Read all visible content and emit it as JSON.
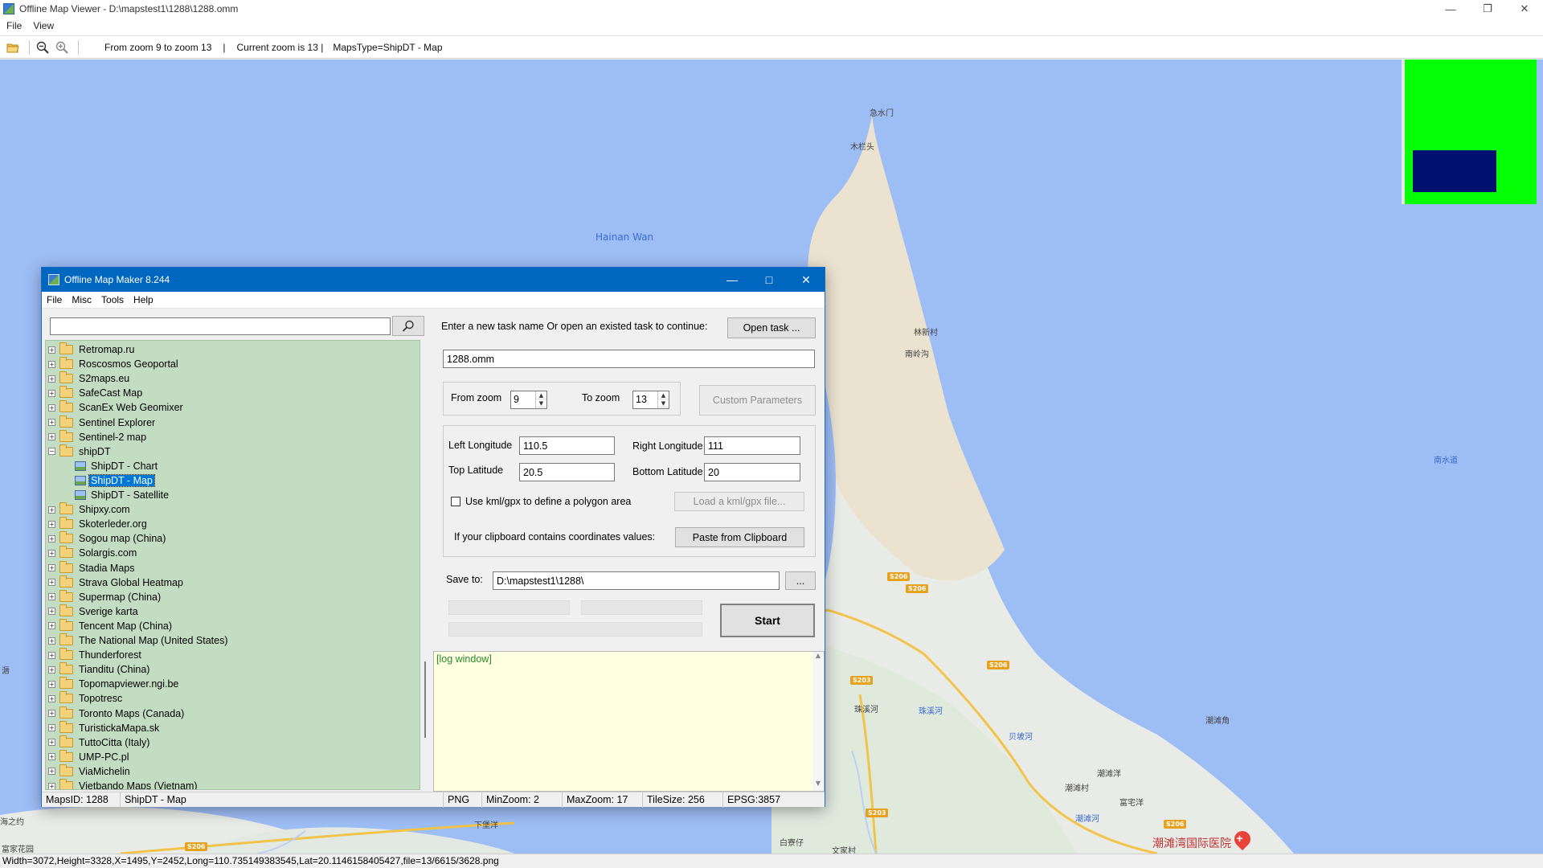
{
  "viewer": {
    "title": "Offline Map Viewer - D:\\mapstest1\\1288\\1288.omm",
    "menu": [
      "File",
      "View"
    ],
    "toolbar": {
      "zoom_range": "From zoom 9 to zoom 13",
      "separator": "|",
      "current_zoom": "Current zoom is 13 |",
      "maps_type": "MapsType=ShipDT - Map"
    },
    "status": "Width=3072,Height=3328,X=1495,Y=2452,Long=110.735149383545,Lat=20.1146158405427,file=13/6615/3628.png"
  },
  "map": {
    "water_labels": [
      "Hainan Wan"
    ],
    "place_labels": [
      "急水门",
      "木栏头",
      "林新村",
      "南岭沟",
      "南水道",
      "珠溪河",
      "珠溪河",
      "贝坡河",
      "潮滩角",
      "潮滩洋",
      "潮滩村",
      "富宅洋",
      "潮滩河",
      "下堡洋",
      "白寮仔",
      "文家村",
      "富家花园",
      "海之约",
      "漘"
    ],
    "road_shields": [
      "S206",
      "S206",
      "S206",
      "S203",
      "S203",
      "S206",
      "S206"
    ],
    "poi": "潮滩湾国际医院",
    "colors": {
      "water": "#9dbdf5",
      "land": "#e9ebe7",
      "sand": "#ebe3cf",
      "minimap": "#05ff05",
      "minimap_view": "#001070"
    }
  },
  "maker": {
    "title": "Offline Map Maker 8.244",
    "menu": [
      "File",
      "Misc",
      "Tools",
      "Help"
    ],
    "search": {
      "value": "",
      "placeholder": ""
    },
    "tree": [
      {
        "label": "Retromap.ru",
        "type": "folder",
        "expanded": false
      },
      {
        "label": "Roscosmos Geoportal",
        "type": "folder",
        "expanded": false
      },
      {
        "label": "S2maps.eu",
        "type": "folder",
        "expanded": false
      },
      {
        "label": "SafeCast Map",
        "type": "folder",
        "expanded": false
      },
      {
        "label": "ScanEx Web Geomixer",
        "type": "folder",
        "expanded": false
      },
      {
        "label": "Sentinel Explorer",
        "type": "folder",
        "expanded": false
      },
      {
        "label": "Sentinel-2 map",
        "type": "folder",
        "expanded": false
      },
      {
        "label": "shipDT",
        "type": "folder",
        "expanded": true
      },
      {
        "label": "ShipDT - Chart",
        "type": "map",
        "child": true
      },
      {
        "label": "ShipDT - Map",
        "type": "map",
        "child": true,
        "selected": true
      },
      {
        "label": "ShipDT - Satellite",
        "type": "map",
        "child": true
      },
      {
        "label": "Shipxy.com",
        "type": "folder",
        "expanded": false
      },
      {
        "label": "Skoterleder.org",
        "type": "folder",
        "expanded": false
      },
      {
        "label": "Sogou map (China)",
        "type": "folder",
        "expanded": false
      },
      {
        "label": "Solargis.com",
        "type": "folder",
        "expanded": false
      },
      {
        "label": "Stadia Maps",
        "type": "folder",
        "expanded": false
      },
      {
        "label": "Strava Global Heatmap",
        "type": "folder",
        "expanded": false
      },
      {
        "label": "Supermap (China)",
        "type": "folder",
        "expanded": false
      },
      {
        "label": "Sverige karta",
        "type": "folder",
        "expanded": false
      },
      {
        "label": "Tencent Map (China)",
        "type": "folder",
        "expanded": false
      },
      {
        "label": "The National Map (United States)",
        "type": "folder",
        "expanded": false
      },
      {
        "label": "Thunderforest",
        "type": "folder",
        "expanded": false
      },
      {
        "label": "Tianditu (China)",
        "type": "folder",
        "expanded": false
      },
      {
        "label": "Topomapviewer.ngi.be",
        "type": "folder",
        "expanded": false
      },
      {
        "label": "Topotresc",
        "type": "folder",
        "expanded": false
      },
      {
        "label": "Toronto Maps (Canada)",
        "type": "folder",
        "expanded": false
      },
      {
        "label": "TuristickaMapa.sk",
        "type": "folder",
        "expanded": false
      },
      {
        "label": "TuttoCitta (Italy)",
        "type": "folder",
        "expanded": false
      },
      {
        "label": "UMP-PC.pl",
        "type": "folder",
        "expanded": false
      },
      {
        "label": "ViaMichelin",
        "type": "folder",
        "expanded": false
      },
      {
        "label": "Vietbando Maps (Vietnam)",
        "type": "folder",
        "expanded": false
      }
    ],
    "task": {
      "prompt": "Enter a new task name Or open an existed task to continue:",
      "open_label": "Open task ...",
      "name_value": "1288.omm"
    },
    "zoom": {
      "from_label": "From zoom",
      "from_value": "9",
      "to_label": "To zoom",
      "to_value": "13",
      "custom_label": "Custom Parameters"
    },
    "coords": {
      "left_lon_label": "Left Longitude",
      "left_lon_value": "110.5",
      "right_lon_label": "Right Longitude",
      "right_lon_value": "111",
      "top_lat_label": "Top Latitude",
      "top_lat_value": "20.5",
      "bottom_lat_label": "Bottom Latitude",
      "bottom_lat_value": "20",
      "kml_label": "Use kml/gpx to define a polygon area",
      "kml_checked": false,
      "load_kml_label": "Load a kml/gpx file...",
      "clipboard_prompt": "If your clipboard contains coordinates values:",
      "paste_label": "Paste from Clipboard"
    },
    "save": {
      "label": "Save to:",
      "value": "D:\\mapstest1\\1288\\",
      "browse_label": "...",
      "start_label": "Start"
    },
    "log": "[log window]",
    "status": {
      "maps_id": "MapsID: 1288",
      "maps_name": "ShipDT - Map",
      "format": "PNG",
      "min_zoom": "MinZoom: 2",
      "max_zoom": "MaxZoom: 17",
      "tile_size": "TileSize: 256",
      "epsg": "EPSG:3857"
    }
  }
}
